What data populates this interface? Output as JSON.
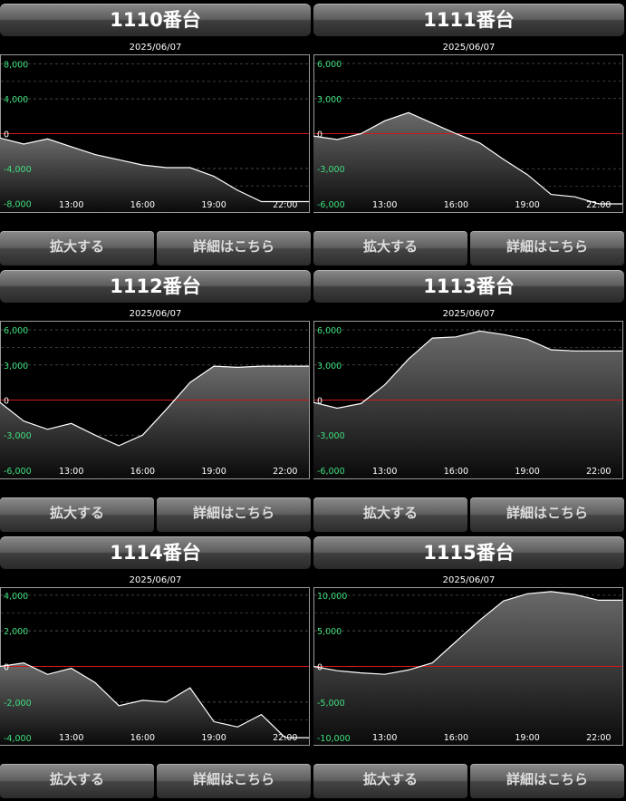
{
  "panels": [
    {
      "title": "1110番台",
      "date": "2025/06/07",
      "zoom_label": "拡大する",
      "detail_label": "詳細はこちら",
      "chart_data": {
        "type": "area",
        "ylim": [
          -9000,
          9000
        ],
        "yticks": [
          "8,000",
          "4,000",
          "0",
          "-4,000",
          "-8,000"
        ],
        "ytick_values": [
          8000,
          4000,
          0,
          -4000,
          -8000
        ],
        "xticks": [
          "13:00",
          "16:00",
          "19:00",
          "22:00"
        ],
        "xtick_values": [
          13,
          16,
          19,
          22
        ],
        "xlim": [
          10,
          23
        ],
        "x": [
          10,
          11,
          12,
          13,
          14,
          15,
          16,
          17,
          18,
          19,
          20,
          21,
          22,
          23
        ],
        "y": [
          -500,
          -1200,
          -600,
          -1500,
          -2400,
          -3000,
          -3600,
          -3900,
          -3900,
          -4900,
          -6500,
          -7800,
          -7800,
          -7800
        ]
      }
    },
    {
      "title": "1111番台",
      "date": "2025/06/07",
      "zoom_label": "拡大する",
      "detail_label": "詳細はこちら",
      "chart_data": {
        "type": "area",
        "ylim": [
          -6700,
          6700
        ],
        "yticks": [
          "6,000",
          "3,000",
          "0",
          "-3,000",
          "-6,000"
        ],
        "ytick_values": [
          6000,
          3000,
          0,
          -3000,
          -6000
        ],
        "xticks": [
          "13:00",
          "16:00",
          "19:00",
          "22:00"
        ],
        "xtick_values": [
          13,
          16,
          19,
          22
        ],
        "xlim": [
          10,
          23
        ],
        "x": [
          10,
          11,
          12,
          13,
          14,
          15,
          16,
          17,
          18,
          19,
          20,
          21,
          22,
          23
        ],
        "y": [
          -200,
          -500,
          0,
          1100,
          1800,
          900,
          0,
          -800,
          -2200,
          -3500,
          -5200,
          -5400,
          -6000,
          -6000
        ]
      }
    },
    {
      "title": "1112番台",
      "date": "2025/06/07",
      "zoom_label": "拡大する",
      "detail_label": "詳細はこちら",
      "chart_data": {
        "type": "area",
        "ylim": [
          -6700,
          6700
        ],
        "yticks": [
          "6,000",
          "3,000",
          "0",
          "-3,000",
          "-6,000"
        ],
        "ytick_values": [
          6000,
          3000,
          0,
          -3000,
          -6000
        ],
        "xticks": [
          "13:00",
          "16:00",
          "19:00",
          "22:00"
        ],
        "xtick_values": [
          13,
          16,
          19,
          22
        ],
        "xlim": [
          10,
          23
        ],
        "x": [
          10,
          11,
          12,
          13,
          14,
          15,
          16,
          17,
          18,
          19,
          20,
          21,
          22,
          23
        ],
        "y": [
          -200,
          -1800,
          -2500,
          -2000,
          -3000,
          -3900,
          -3000,
          -800,
          1500,
          2900,
          2800,
          2900,
          2900,
          2900
        ]
      }
    },
    {
      "title": "1113番台",
      "date": "2025/06/07",
      "zoom_label": "拡大する",
      "detail_label": "詳細はこちら",
      "chart_data": {
        "type": "area",
        "ylim": [
          -6700,
          6700
        ],
        "yticks": [
          "6,000",
          "3,000",
          "0",
          "-3,000",
          "-6,000"
        ],
        "ytick_values": [
          6000,
          3000,
          0,
          -3000,
          -6000
        ],
        "xticks": [
          "13:00",
          "16:00",
          "19:00",
          "22:00"
        ],
        "xtick_values": [
          13,
          16,
          19,
          22
        ],
        "xlim": [
          10,
          23
        ],
        "x": [
          10,
          11,
          12,
          13,
          14,
          15,
          16,
          17,
          18,
          19,
          20,
          21,
          22,
          23
        ],
        "y": [
          -200,
          -700,
          -300,
          1300,
          3500,
          5300,
          5400,
          5900,
          5600,
          5200,
          4300,
          4200,
          4200,
          4200
        ]
      }
    },
    {
      "title": "1114番台",
      "date": "2025/06/07",
      "zoom_label": "拡大する",
      "detail_label": "詳細はこちら",
      "chart_data": {
        "type": "area",
        "ylim": [
          -4400,
          4400
        ],
        "yticks": [
          "4,000",
          "2,000",
          "0",
          "-2,000",
          "-4,000"
        ],
        "ytick_values": [
          4000,
          2000,
          0,
          -2000,
          -4000
        ],
        "xticks": [
          "13:00",
          "16:00",
          "19:00",
          "22:00"
        ],
        "xtick_values": [
          13,
          16,
          19,
          22
        ],
        "xlim": [
          10,
          23
        ],
        "x": [
          10,
          11,
          12,
          13,
          14,
          15,
          16,
          17,
          18,
          19,
          20,
          21,
          22,
          23
        ],
        "y": [
          0,
          200,
          -450,
          -100,
          -900,
          -2200,
          -1900,
          -2000,
          -1200,
          -3100,
          -3400,
          -2700,
          -4000,
          -4000
        ]
      }
    },
    {
      "title": "1115番台",
      "date": "2025/06/07",
      "zoom_label": "拡大する",
      "detail_label": "詳細はこちら",
      "chart_data": {
        "type": "area",
        "ylim": [
          -11000,
          11000
        ],
        "yticks": [
          "10,000",
          "5,000",
          "0",
          "-5,000",
          "-10,000"
        ],
        "ytick_values": [
          10000,
          5000,
          0,
          -5000,
          -10000
        ],
        "xticks": [
          "13:00",
          "16:00",
          "19:00",
          "22:00"
        ],
        "xtick_values": [
          13,
          16,
          19,
          22
        ],
        "xlim": [
          10,
          23
        ],
        "x": [
          10,
          11,
          12,
          13,
          14,
          15,
          16,
          17,
          18,
          19,
          20,
          21,
          22,
          23
        ],
        "y": [
          0,
          -600,
          -900,
          -1100,
          -500,
          500,
          3500,
          6500,
          9200,
          10200,
          10500,
          10100,
          9300,
          9300
        ]
      }
    }
  ]
}
